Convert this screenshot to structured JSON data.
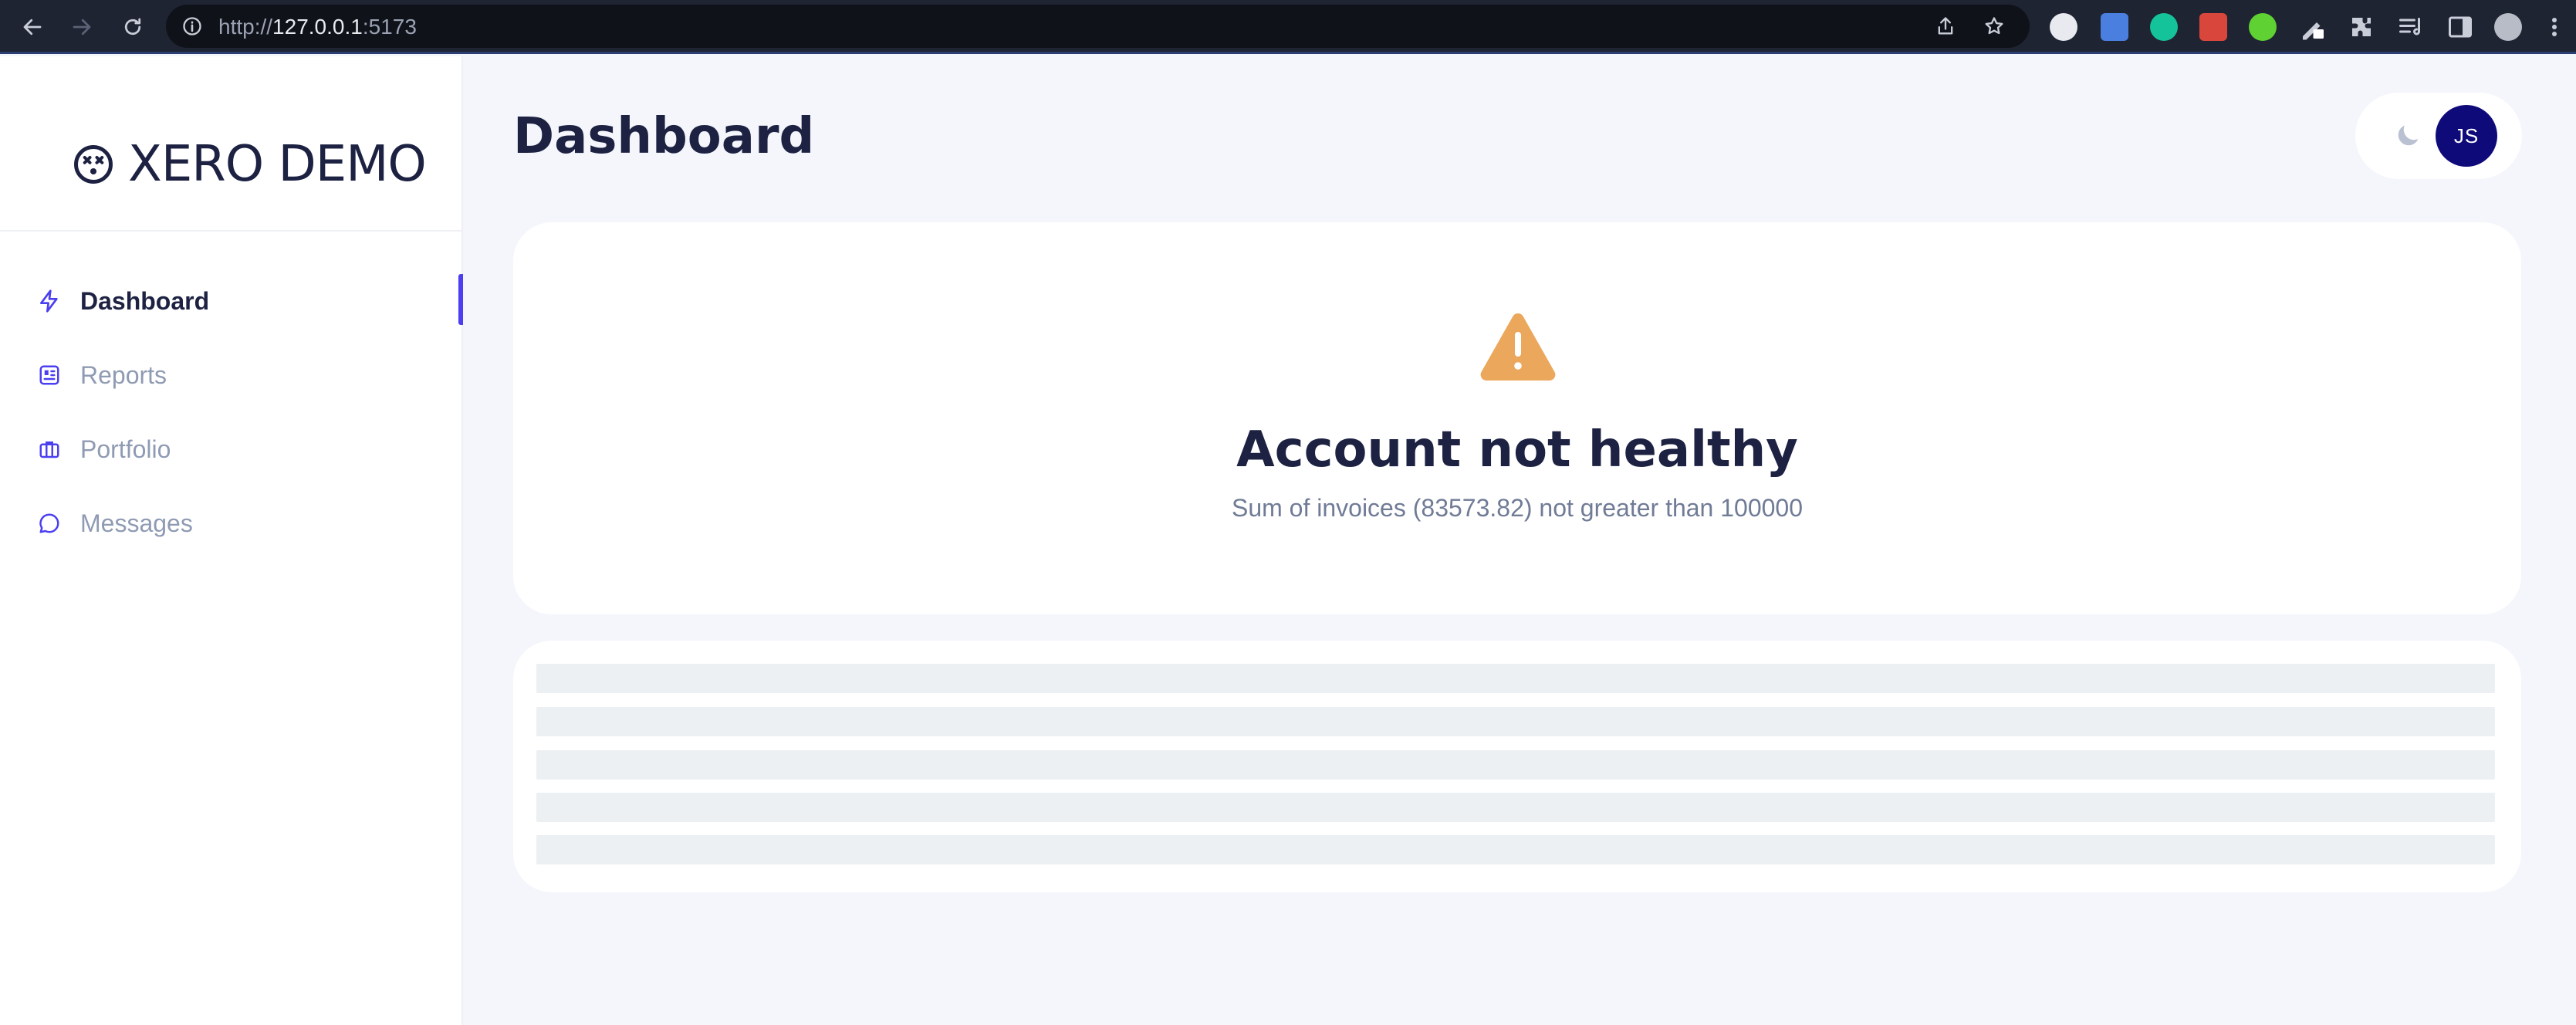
{
  "browser": {
    "url_scheme": "http://",
    "url_host": "127.0.0.1",
    "url_port": ":5173"
  },
  "sidebar": {
    "logo_text": "XERO DEMO",
    "items": [
      {
        "label": "Dashboard",
        "icon": "bolt-icon",
        "active": true
      },
      {
        "label": "Reports",
        "icon": "reports-icon",
        "active": false
      },
      {
        "label": "Portfolio",
        "icon": "briefcase-icon",
        "active": false
      },
      {
        "label": "Messages",
        "icon": "chat-icon",
        "active": false
      }
    ]
  },
  "header": {
    "title": "Dashboard",
    "avatar_initials": "JS"
  },
  "alert": {
    "title": "Account not healthy",
    "message": "Sum of invoices (83573.82) not greater than 100000"
  },
  "colors": {
    "accent": "#4b3ff0",
    "avatar_bg": "#0f0a7a",
    "warning": "#eba75c",
    "text_dark": "#1d2243",
    "muted": "#8f9bb3"
  }
}
